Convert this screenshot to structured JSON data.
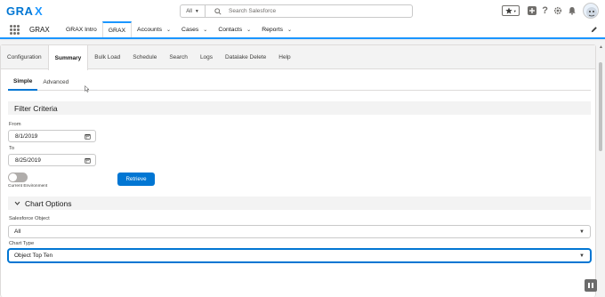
{
  "brand": {
    "logo_text": "GRAX",
    "accent_color": "#0176d3",
    "nav_highlight_color": "#1b96ff"
  },
  "search": {
    "scope_label": "All",
    "placeholder": "Search Salesforce"
  },
  "header_icons": [
    "star-icon",
    "chevron-down-icon",
    "add-icon",
    "help-icon",
    "gear-icon",
    "bell-icon",
    "avatar"
  ],
  "nav": {
    "app_name": "GRAX",
    "items": [
      {
        "label": "GRAX Intro",
        "dropdown": false,
        "active": false
      },
      {
        "label": "GRAX",
        "dropdown": false,
        "active": true
      },
      {
        "label": "Accounts",
        "dropdown": true,
        "active": false
      },
      {
        "label": "Cases",
        "dropdown": true,
        "active": false
      },
      {
        "label": "Contacts",
        "dropdown": true,
        "active": false
      },
      {
        "label": "Reports",
        "dropdown": true,
        "active": false
      }
    ]
  },
  "tabs": [
    {
      "label": "Configuration",
      "active": false
    },
    {
      "label": "Summary",
      "active": true
    },
    {
      "label": "Bulk Load",
      "active": false
    },
    {
      "label": "Schedule",
      "active": false
    },
    {
      "label": "Search",
      "active": false
    },
    {
      "label": "Logs",
      "active": false
    },
    {
      "label": "Datalake Delete",
      "active": false
    },
    {
      "label": "Help",
      "active": false
    }
  ],
  "subtabs": [
    {
      "label": "Simple",
      "active": true
    },
    {
      "label": "Advanced",
      "active": false
    }
  ],
  "filter_criteria": {
    "title": "Filter Criteria",
    "from_label": "From",
    "from_value": "8/1/2019",
    "to_label": "To",
    "to_value": "8/25/2019",
    "toggle_label": "Current Environment",
    "toggle_on": false,
    "retrieve_label": "Retrieve"
  },
  "chart_options": {
    "title": "Chart Options",
    "object_label": "Salesforce Object",
    "object_value": "All",
    "chart_type_label": "Chart Type",
    "chart_type_value": "Object Top Ten"
  }
}
